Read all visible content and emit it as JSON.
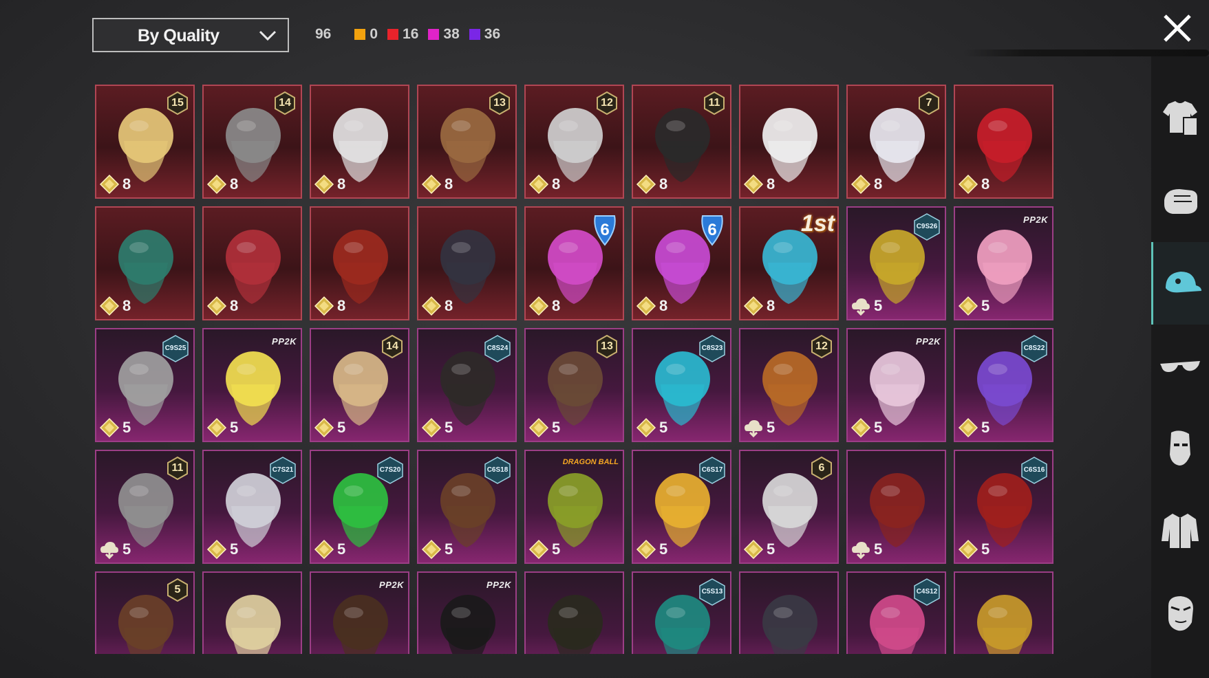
{
  "toolbar": {
    "sort_label": "By Quality",
    "total_count": "96",
    "quality_counts": [
      {
        "color": "#f2a20e",
        "value": "0"
      },
      {
        "color": "#e8232b",
        "value": "16"
      },
      {
        "color": "#e023c8",
        "value": "38"
      },
      {
        "color": "#7a26e6",
        "value": "36"
      }
    ]
  },
  "sidebar": {
    "items": [
      {
        "icon": "outfit-icon",
        "active": false
      },
      {
        "icon": "glove-icon",
        "active": false
      },
      {
        "icon": "cap-icon",
        "active": true
      },
      {
        "icon": "glasses-icon",
        "active": false
      },
      {
        "icon": "mask-icon",
        "active": false
      },
      {
        "icon": "jacket-icon",
        "active": false
      },
      {
        "icon": "face-icon",
        "active": false
      }
    ]
  },
  "items": [
    {
      "quality": "red",
      "cost": "8",
      "cost_icon": "gem",
      "badge": "15",
      "art": "hair-blonde"
    },
    {
      "quality": "red",
      "cost": "8",
      "cost_icon": "gem",
      "badge": "14",
      "art": "mask-cat"
    },
    {
      "quality": "red",
      "cost": "8",
      "cost_icon": "gem",
      "badge": "",
      "art": "hair-horns"
    },
    {
      "quality": "red",
      "cost": "8",
      "cost_icon": "gem",
      "badge": "13",
      "art": "hat-flower"
    },
    {
      "quality": "red",
      "cost": "8",
      "cost_icon": "gem",
      "badge": "12",
      "art": "hair-white"
    },
    {
      "quality": "red",
      "cost": "8",
      "cost_icon": "gem",
      "badge": "11",
      "art": "hair-black"
    },
    {
      "quality": "red",
      "cost": "8",
      "cost_icon": "gem",
      "badge": "",
      "art": "hat-cowboy"
    },
    {
      "quality": "red",
      "cost": "8",
      "cost_icon": "gem",
      "badge": "7",
      "art": "hair-long-white"
    },
    {
      "quality": "red",
      "cost": "8",
      "cost_icon": "gem",
      "badge": "",
      "art": "helmet-red"
    },
    {
      "quality": "red",
      "cost": "8",
      "cost_icon": "gem",
      "badge": "",
      "art": "helmet-dragon"
    },
    {
      "quality": "red",
      "cost": "8",
      "cost_icon": "gem",
      "badge": "",
      "art": "mask-fox"
    },
    {
      "quality": "red",
      "cost": "8",
      "cost_icon": "gem",
      "badge": "",
      "art": "helmet-red-2"
    },
    {
      "quality": "red",
      "cost": "8",
      "cost_icon": "gem",
      "badge": "",
      "art": "helmet-knight"
    },
    {
      "quality": "red",
      "cost": "8",
      "cost_icon": "gem",
      "tag6": "6",
      "art": "helmet-tv"
    },
    {
      "quality": "red",
      "cost": "8",
      "cost_icon": "gem",
      "tag6": "6",
      "art": "helmet-tv-2"
    },
    {
      "quality": "red",
      "cost": "8",
      "cost_icon": "gem",
      "tag1st": "1st",
      "art": "helmet-space"
    },
    {
      "quality": "pink",
      "cost": "5",
      "cost_icon": "cloud",
      "season": "C9S26",
      "art": "hat-bee"
    },
    {
      "quality": "pink",
      "cost": "5",
      "cost_icon": "gem",
      "ppc": "PP2K",
      "art": "headband-bow"
    },
    {
      "quality": "pink",
      "cost": "5",
      "cost_icon": "gem",
      "season": "C9S25",
      "art": "hair-gray"
    },
    {
      "quality": "pink",
      "cost": "5",
      "cost_icon": "gem",
      "ppc": "PP2K",
      "art": "mask-box"
    },
    {
      "quality": "pink",
      "cost": "5",
      "cost_icon": "gem",
      "badge": "14",
      "art": "hair-blonde-2"
    },
    {
      "quality": "pink",
      "cost": "5",
      "cost_icon": "gem",
      "season": "C8S24",
      "art": "hair-dark"
    },
    {
      "quality": "pink",
      "cost": "5",
      "cost_icon": "gem",
      "badge": "13",
      "art": "goggles"
    },
    {
      "quality": "pink",
      "cost": "5",
      "cost_icon": "gem",
      "season": "C8S23",
      "art": "hair-headphones"
    },
    {
      "quality": "pink",
      "cost": "5",
      "cost_icon": "cloud",
      "badge": "12",
      "art": "hair-orange"
    },
    {
      "quality": "pink",
      "cost": "5",
      "cost_icon": "gem",
      "ppc": "PP2K",
      "art": "hair-pink"
    },
    {
      "quality": "pink",
      "cost": "5",
      "cost_icon": "gem",
      "season": "C8S22",
      "art": "hair-blue"
    },
    {
      "quality": "pink",
      "cost": "5",
      "cost_icon": "cloud",
      "badge": "11",
      "art": "hair-veil"
    },
    {
      "quality": "pink",
      "cost": "5",
      "cost_icon": "gem",
      "season": "C7S21",
      "art": "hair-silver"
    },
    {
      "quality": "pink",
      "cost": "5",
      "cost_icon": "gem",
      "season": "C7S20",
      "art": "hair-green"
    },
    {
      "quality": "pink",
      "cost": "5",
      "cost_icon": "gem",
      "season": "C6S18",
      "art": "hair-brown"
    },
    {
      "quality": "pink",
      "cost": "5",
      "cost_icon": "gem",
      "dbz": "DRAGON BALL",
      "art": "hat-green"
    },
    {
      "quality": "pink",
      "cost": "5",
      "cost_icon": "gem",
      "season": "C6S17",
      "art": "cap-visor"
    },
    {
      "quality": "pink",
      "cost": "5",
      "cost_icon": "gem",
      "badge": "6",
      "art": "helmet-blade"
    },
    {
      "quality": "pink",
      "cost": "5",
      "cost_icon": "cloud",
      "badge": "",
      "art": "hair-red"
    },
    {
      "quality": "pink",
      "cost": "5",
      "cost_icon": "gem",
      "season": "C6S16",
      "art": "hair-red-2"
    },
    {
      "quality": "pink",
      "cost": "",
      "cost_icon": "",
      "badge": "5",
      "art": "hair-ears"
    },
    {
      "quality": "pink",
      "cost": "",
      "cost_icon": "",
      "badge": "",
      "art": "hair-curls"
    },
    {
      "quality": "pink",
      "cost": "",
      "cost_icon": "",
      "ppc": "PP2K",
      "art": "hair-braid"
    },
    {
      "quality": "pink",
      "cost": "",
      "cost_icon": "",
      "ppc": "PP2K",
      "art": "mask-black"
    },
    {
      "quality": "pink",
      "cost": "",
      "cost_icon": "",
      "badge": "",
      "art": "hat-wide"
    },
    {
      "quality": "pink",
      "cost": "",
      "cost_icon": "",
      "season": "C5S13",
      "art": "hat-teal"
    },
    {
      "quality": "pink",
      "cost": "",
      "cost_icon": "",
      "badge": "",
      "art": "helmet-cyber"
    },
    {
      "quality": "pink",
      "cost": "",
      "cost_icon": "",
      "season": "C4S12",
      "art": "cap-pink"
    },
    {
      "quality": "pink",
      "cost": "",
      "cost_icon": "",
      "badge": "",
      "art": "mask-potato"
    }
  ]
}
